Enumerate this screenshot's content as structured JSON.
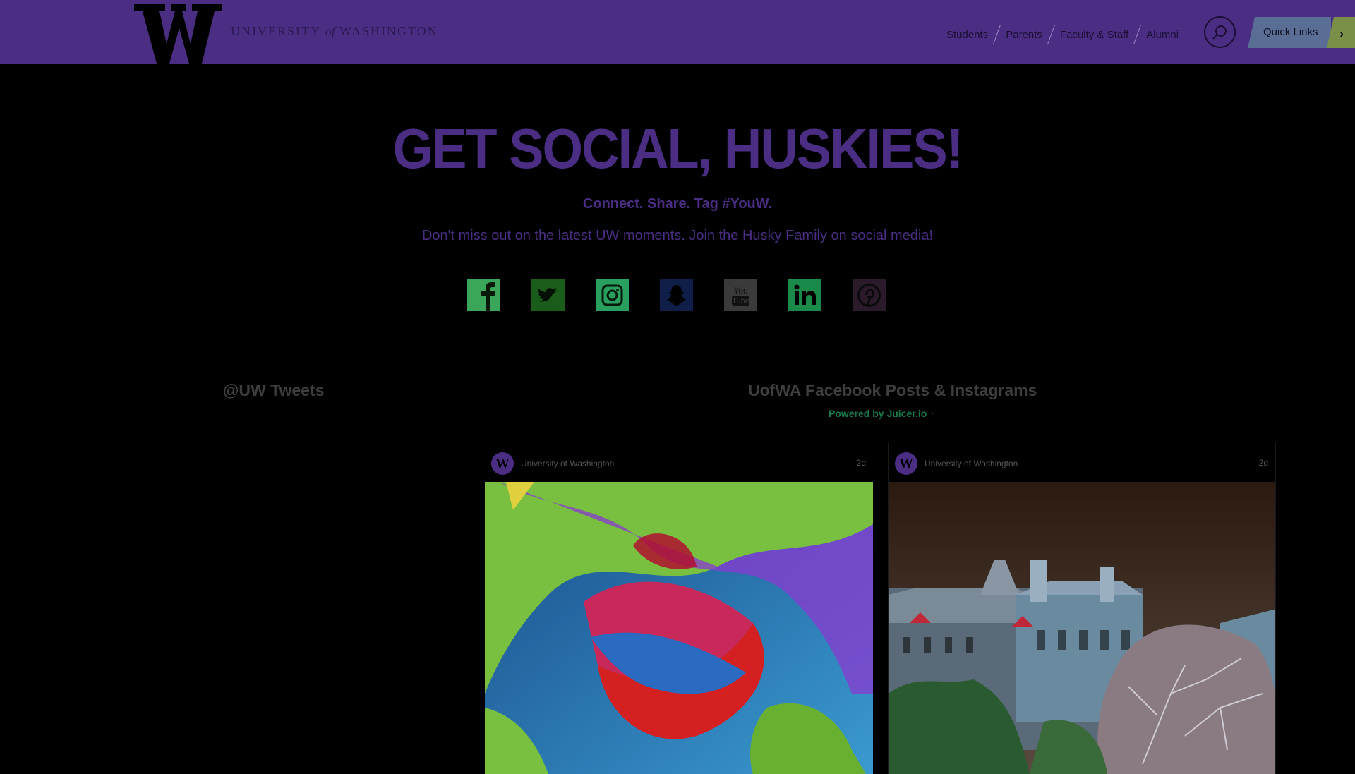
{
  "header": {
    "logo_letter": "W",
    "wordmark_left": "UNIVERSITY",
    "wordmark_of": "of",
    "wordmark_right": "WASHINGTON",
    "nav": [
      "Students",
      "Parents",
      "Faculty & Staff",
      "Alumni"
    ],
    "search_icon": "search-icon",
    "quick_links_label": "Quick Links",
    "quick_links_icon": "chevron-right-icon"
  },
  "hero": {
    "title": "GET SOCIAL, HUSKIES!",
    "tagline": "Connect. Share. Tag #YouW.",
    "subline": "Don't miss out on the latest UW moments. Join the Husky Family on social media!"
  },
  "social_links": [
    {
      "name": "facebook-icon",
      "color": "#3aa65a"
    },
    {
      "name": "twitter-icon",
      "color": "#1a5c1a"
    },
    {
      "name": "instagram-icon",
      "color": "#2aa060"
    },
    {
      "name": "snapchat-icon",
      "color": "#0f1f4a"
    },
    {
      "name": "youtube-icon",
      "color": "#3a3a3a"
    },
    {
      "name": "linkedin-icon",
      "color": "#1a8a4a"
    },
    {
      "name": "pinterest-icon",
      "color": "#2a1a2a"
    }
  ],
  "feeds": {
    "tweets_title": "@UW Tweets",
    "fb_title": "UofWA Facebook Posts & Instagrams",
    "powered_by": "Powered by Juicer.io"
  },
  "posts": [
    {
      "avatar": "W",
      "author": "University of Washington",
      "age": "2d"
    },
    {
      "avatar": "W",
      "author": "University of Washington",
      "age": "2d"
    }
  ],
  "colors": {
    "brand_purple": "#4b2e83",
    "background": "#000000"
  }
}
